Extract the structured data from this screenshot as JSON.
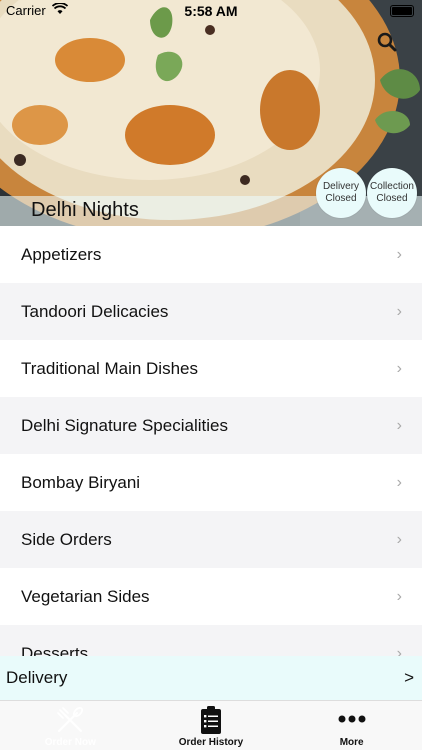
{
  "status_bar": {
    "carrier": "Carrier",
    "time": "5:58 AM"
  },
  "restaurant": {
    "name": "Delhi Nights"
  },
  "badges": {
    "delivery": {
      "line1": "Delivery",
      "line2": "Closed"
    },
    "collection": {
      "line1": "Collection",
      "line2": "Closed"
    }
  },
  "menu": {
    "items": [
      {
        "label": "Appetizers"
      },
      {
        "label": "Tandoori Delicacies"
      },
      {
        "label": "Traditional Main Dishes"
      },
      {
        "label": "Delhi Signature Specialities"
      },
      {
        "label": "Bombay Biryani"
      },
      {
        "label": "Side Orders"
      },
      {
        "label": "Vegetarian Sides"
      },
      {
        "label": "Desserts"
      }
    ],
    "chevron": "›"
  },
  "delivery_bar": {
    "label": "Delivery",
    "arrow": ">"
  },
  "tabs": [
    {
      "label": "Order Now",
      "icon": "fork-knife-icon"
    },
    {
      "label": "Order History",
      "icon": "clipboard-icon"
    },
    {
      "label": "More",
      "icon": "more-dots-icon"
    }
  ]
}
